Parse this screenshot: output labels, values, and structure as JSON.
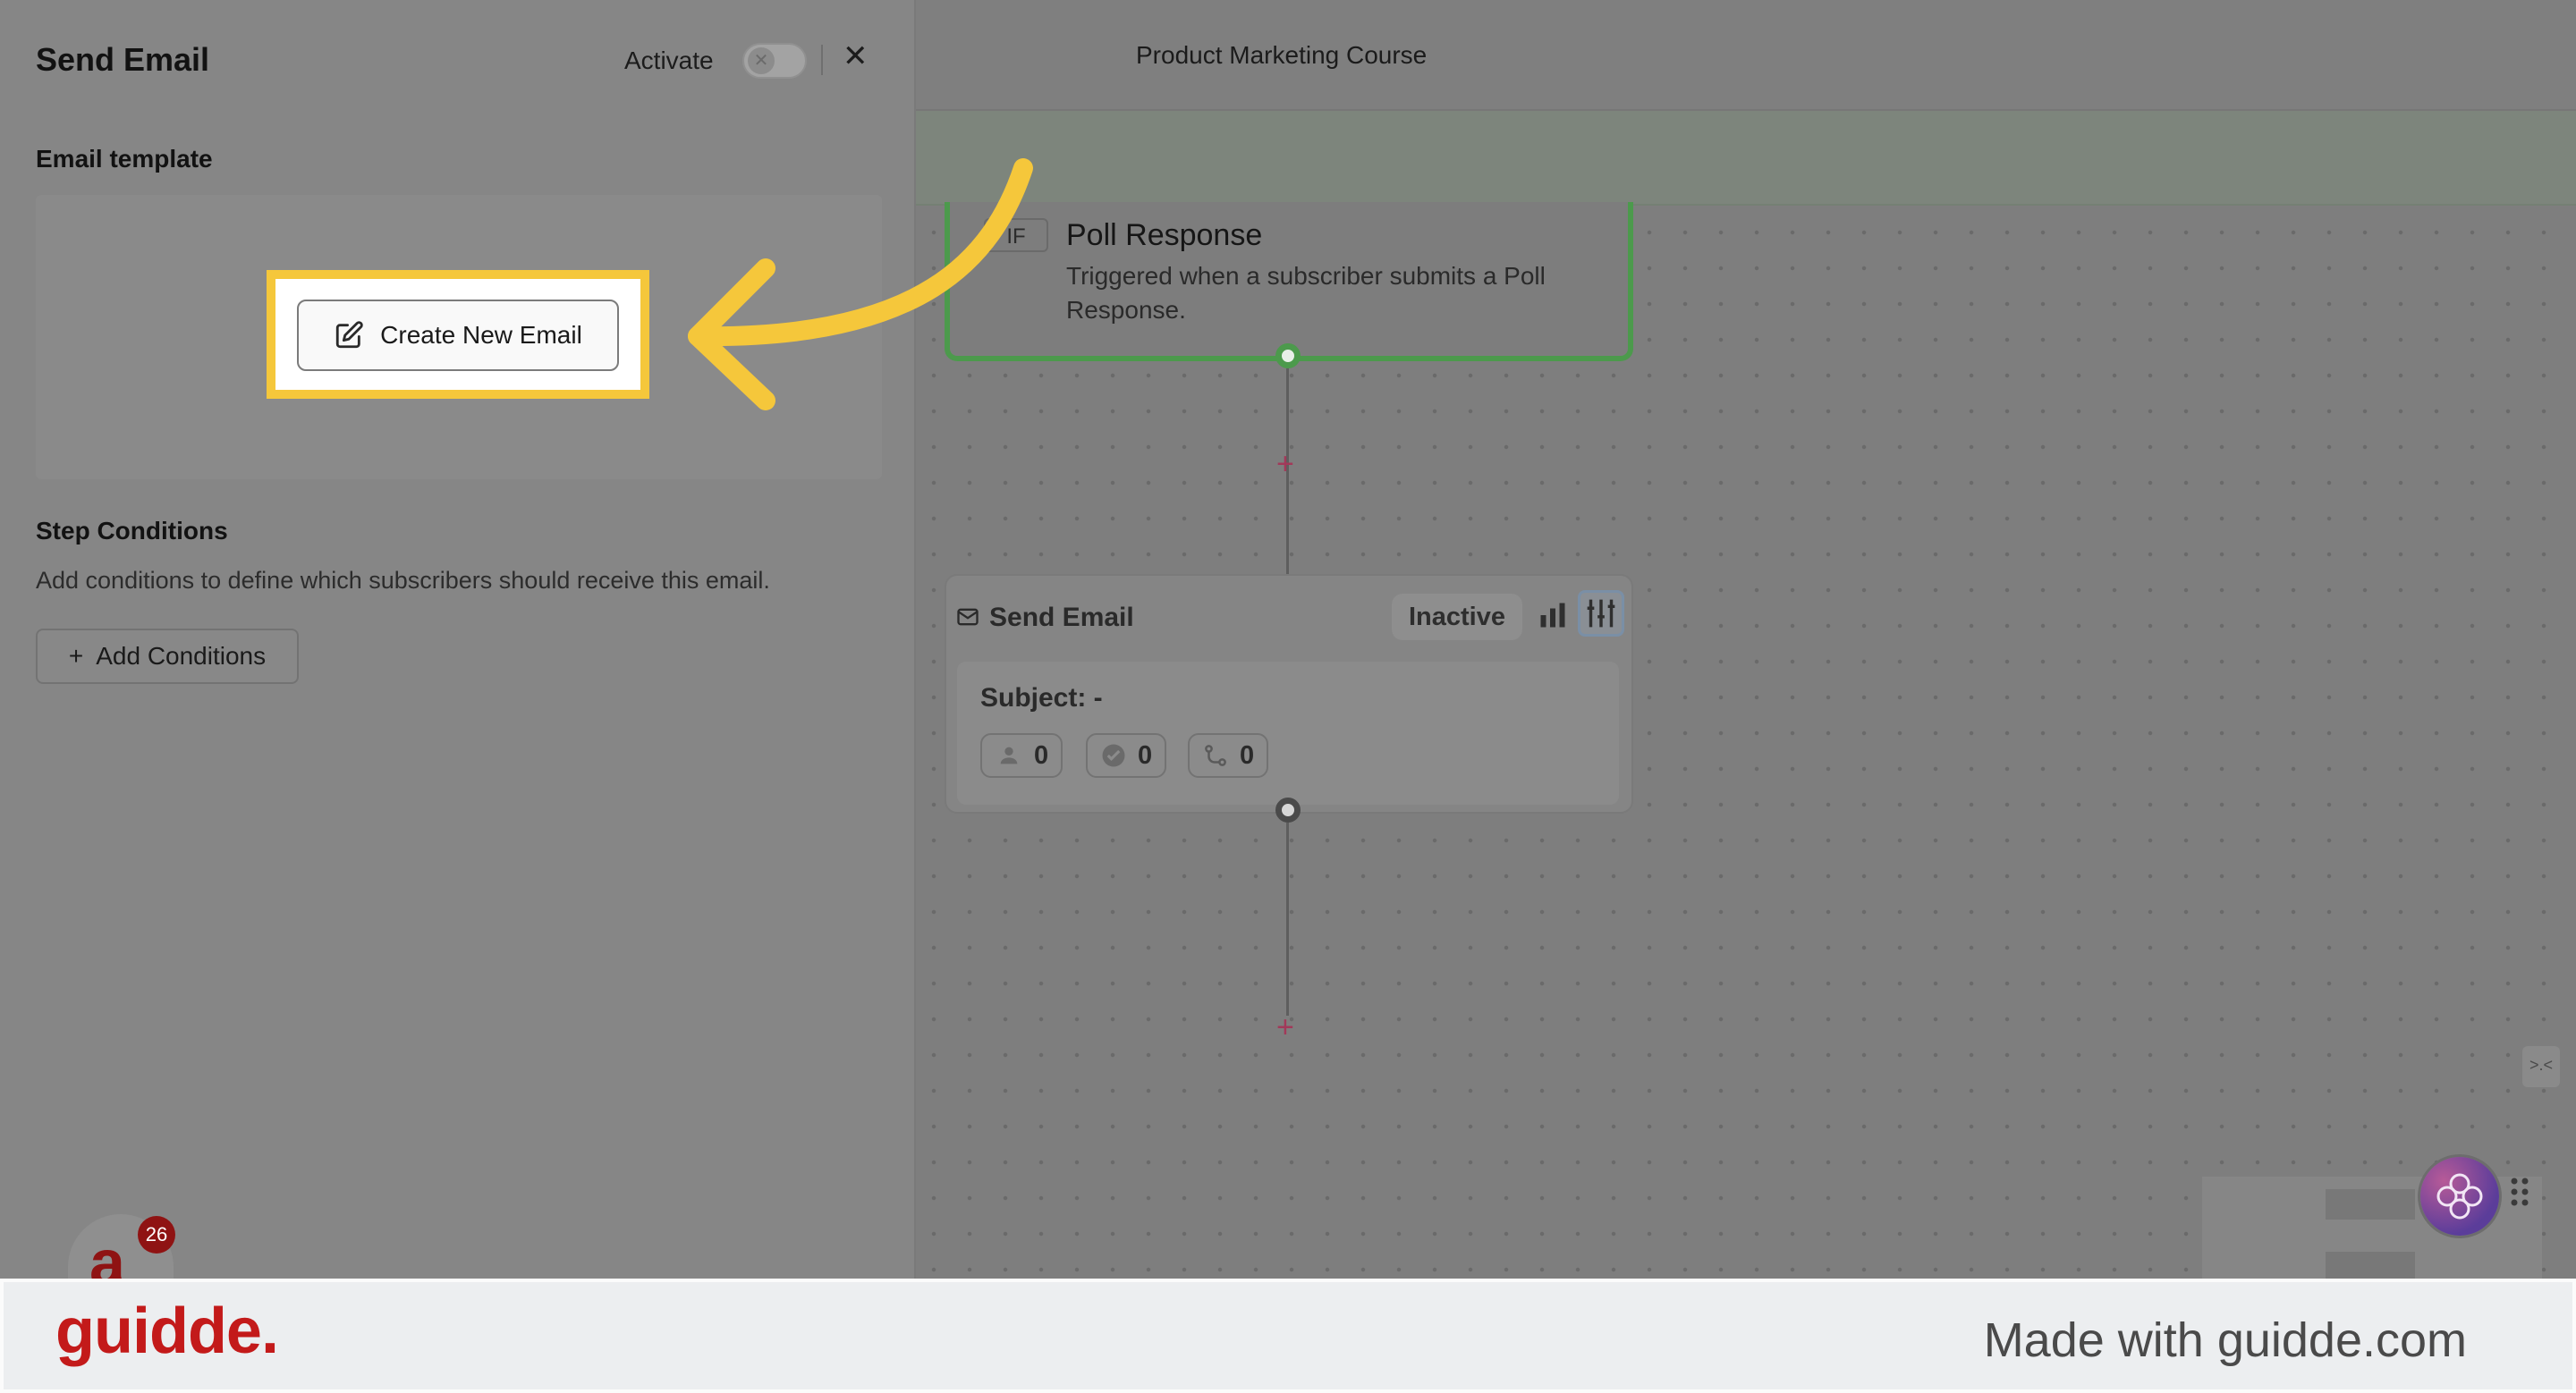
{
  "panel": {
    "title": "Send Email",
    "activate_label": "Activate",
    "email_template_label": "Email template",
    "create_email_button": "Create New Email",
    "step_conditions_label": "Step Conditions",
    "step_conditions_desc": "Add conditions to define which subscribers should receive this email.",
    "add_conditions_button": "Add Conditions",
    "toggle_on": false
  },
  "avatar": {
    "letter": "a",
    "badge_count": "26"
  },
  "canvas": {
    "course_title": "Product Marketing Course",
    "trigger": {
      "tag": "IF",
      "title": "Poll Response",
      "description": "Triggered when a subscriber submits a Poll Response."
    },
    "email_step": {
      "title": "Send Email",
      "status": "Inactive",
      "subject": "Subject: -",
      "stats": [
        "0",
        "0",
        "0"
      ]
    },
    "collapse_icon_text": ">.<"
  },
  "footer": {
    "logo": "guidde.",
    "made_with": "Made with guidde.com"
  },
  "colors": {
    "highlight": "#f5c73b",
    "arrow": "#f5c73b",
    "trigger_border": "#4c9a4c",
    "brand_red": "#c31a1a"
  }
}
